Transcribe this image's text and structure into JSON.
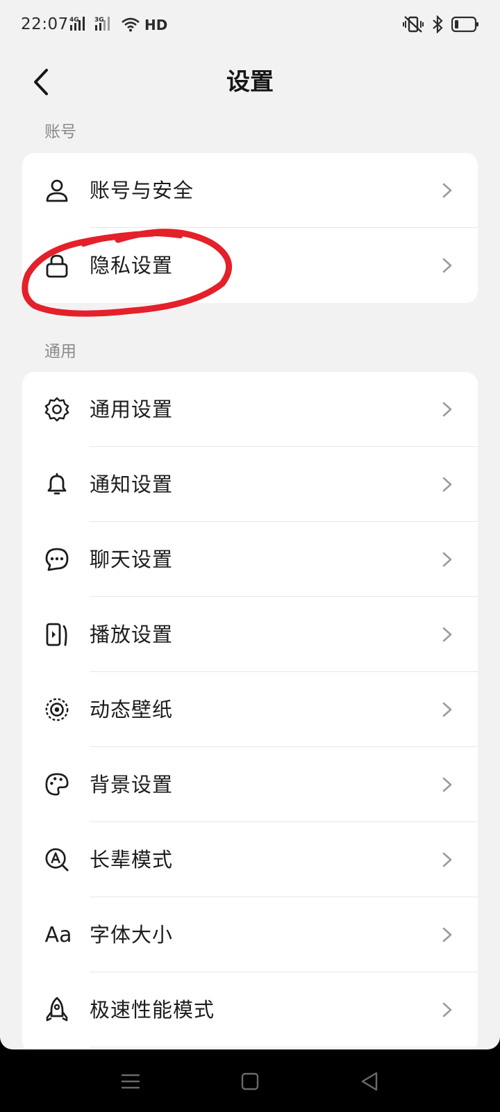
{
  "status": {
    "time": "22:07",
    "sim1": "4G",
    "sim2": "3G",
    "hd": "HD"
  },
  "header": {
    "title": "设置"
  },
  "sections": [
    {
      "label": "账号",
      "items": [
        {
          "label": "账号与安全",
          "icon": "person-icon"
        },
        {
          "label": "隐私设置",
          "icon": "lock-icon"
        }
      ]
    },
    {
      "label": "通用",
      "items": [
        {
          "label": "通用设置",
          "icon": "gear-icon"
        },
        {
          "label": "通知设置",
          "icon": "bell-icon"
        },
        {
          "label": "聊天设置",
          "icon": "chat-bubble-icon"
        },
        {
          "label": "播放设置",
          "icon": "play-phone-icon"
        },
        {
          "label": "动态壁纸",
          "icon": "live-wallpaper-icon"
        },
        {
          "label": "背景设置",
          "icon": "palette-icon"
        },
        {
          "label": "长辈模式",
          "icon": "elder-mode-icon"
        },
        {
          "label": "字体大小",
          "icon": "font-size-icon",
          "glyph": "Aa"
        },
        {
          "label": "极速性能模式",
          "icon": "rocket-icon"
        }
      ]
    }
  ],
  "annotation_color": "#e4202a"
}
